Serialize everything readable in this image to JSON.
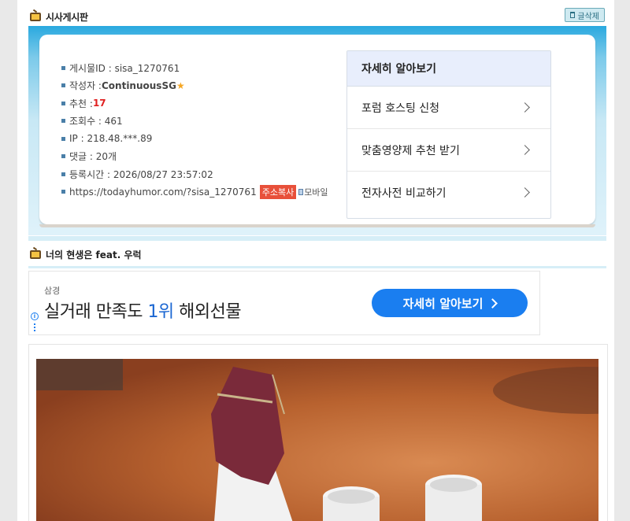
{
  "board": {
    "title": "시사게시판",
    "delete_label": "글삭제"
  },
  "post_meta": [
    {
      "label": "게시물ID : sisa_1270761"
    },
    {
      "label": "작성자 : ",
      "nickname": "ContinuousSG",
      "star": "★"
    },
    {
      "label": "추천 : ",
      "value": "17"
    },
    {
      "label": "조회수 : 461"
    },
    {
      "label": "IP : 218.48.***.89"
    },
    {
      "label": "댓글 : 20개"
    },
    {
      "label": "등록시간 : 2026/08/27 23:57:02"
    },
    {
      "label": "https://todayhumor.com/?sisa_1270761",
      "copy": "주소복사",
      "mobile": "모바일"
    }
  ],
  "learn_more": {
    "title": "자세히 알아보기",
    "items": [
      "포럼 호스팅 신청",
      "맞춤영양제 추천 받기",
      "전자사전 비교하기"
    ]
  },
  "post": {
    "title": "너의 현생은 feat. 우럭"
  },
  "ad": {
    "source": "삼경",
    "headline_pre": "실거래 만족도 ",
    "headline_hl": "1위",
    "headline_post": " 해외선물",
    "button": "자세히 알아보기",
    "info_icon": "i"
  },
  "colors": {
    "accent_blue": "#1a7ef0",
    "recommend_red": "#e02020",
    "band_top": "#2aa9df"
  },
  "photo_description_icon": "soju-bottle-and-cups-photo"
}
